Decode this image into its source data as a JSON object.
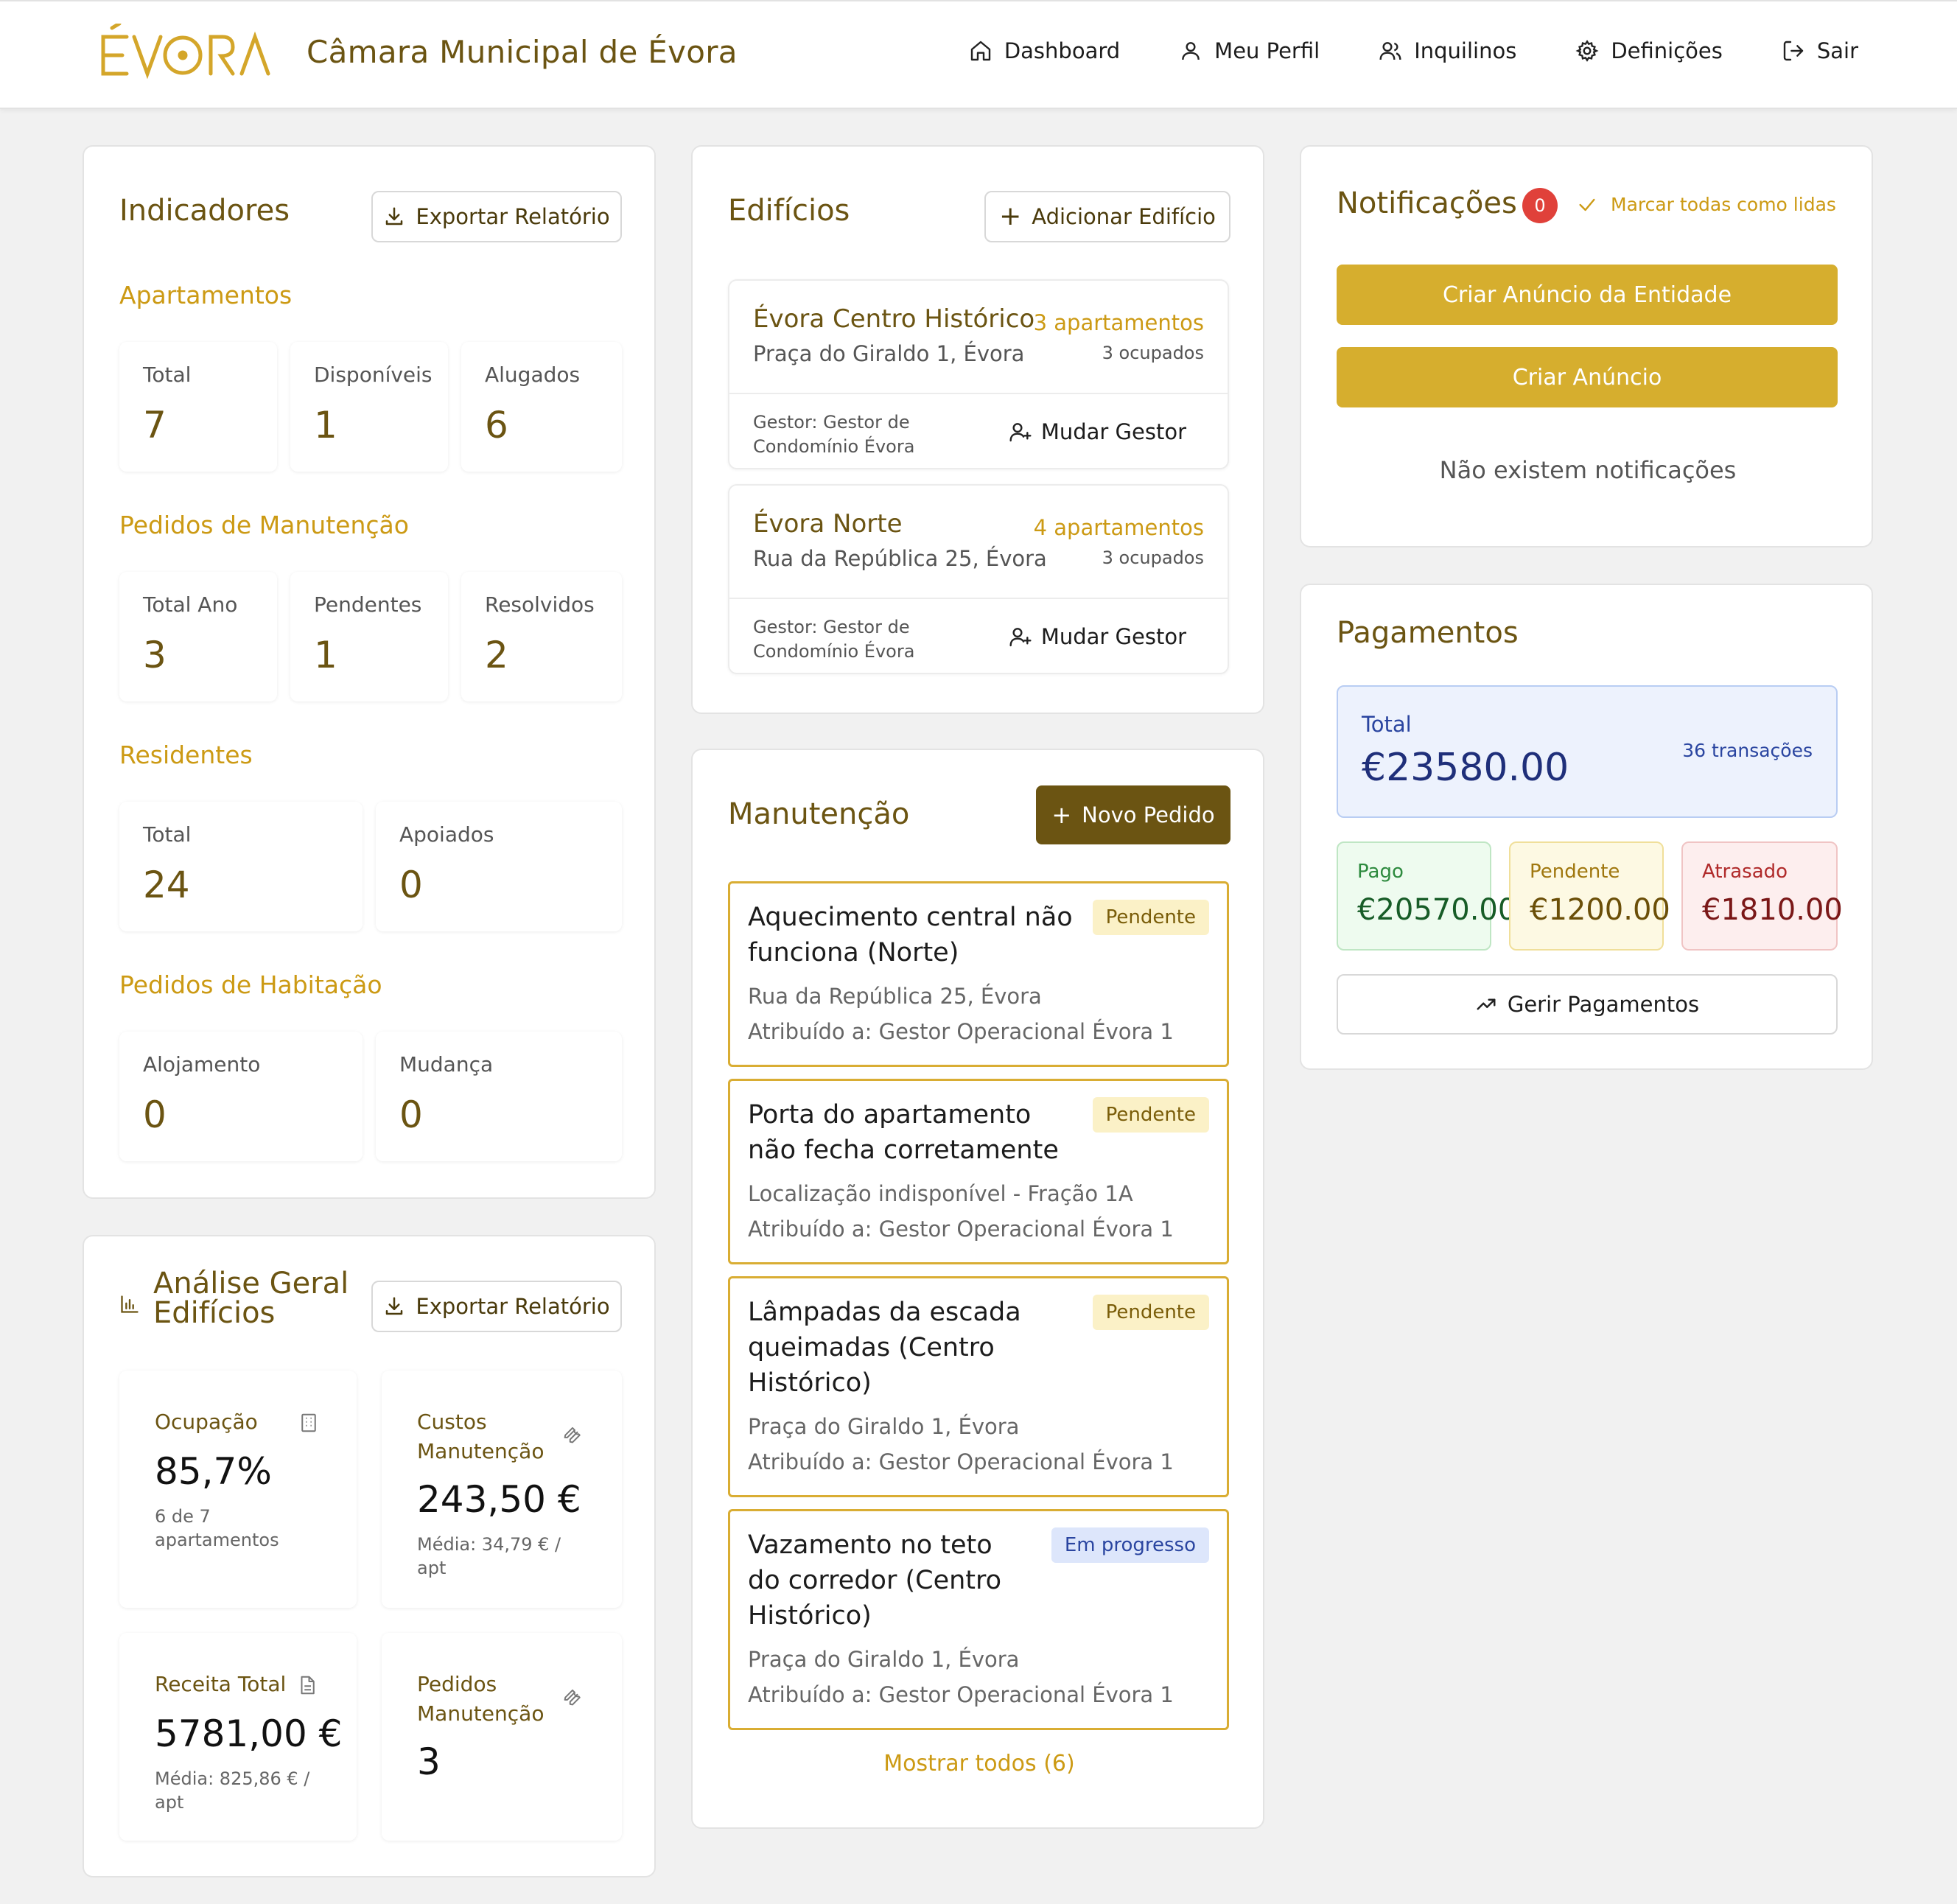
{
  "header": {
    "logo_text": "ÉVORA",
    "brand": "Câmara Municipal de Évora",
    "nav": [
      {
        "label": "Dashboard",
        "icon": "home-icon"
      },
      {
        "label": "Meu Perfil",
        "icon": "user-icon"
      },
      {
        "label": "Inquilinos",
        "icon": "users-icon"
      },
      {
        "label": "Definições",
        "icon": "gear-icon"
      },
      {
        "label": "Sair",
        "icon": "logout-icon"
      }
    ]
  },
  "indicadores": {
    "title": "Indicadores",
    "export_label": "Exportar Relatório",
    "apartamentos": {
      "heading": "Apartamentos",
      "stats": [
        {
          "label": "Total",
          "value": "7"
        },
        {
          "label": "Disponíveis",
          "value": "1"
        },
        {
          "label": "Alugados",
          "value": "6"
        }
      ]
    },
    "manutencao": {
      "heading": "Pedidos de Manutenção",
      "stats": [
        {
          "label": "Total Ano",
          "value": "3"
        },
        {
          "label": "Pendentes",
          "value": "1"
        },
        {
          "label": "Resolvidos",
          "value": "2"
        }
      ]
    },
    "residentes": {
      "heading": "Residentes",
      "stats": [
        {
          "label": "Total",
          "value": "24"
        },
        {
          "label": "Apoiados",
          "value": "0"
        }
      ]
    },
    "habitacao": {
      "heading": "Pedidos de Habitação",
      "stats": [
        {
          "label": "Alojamento",
          "value": "0"
        },
        {
          "label": "Mudança",
          "value": "0"
        }
      ]
    }
  },
  "analise": {
    "title_line1": "Análise Geral",
    "title_line2": "Edifícios",
    "export_label": "Exportar Relatório",
    "cards": [
      {
        "label": "Ocupação",
        "value": "85,7%",
        "sub": "6 de 7 apartamentos",
        "icon": "building-icon"
      },
      {
        "label": "Custos Manutenção",
        "value": "243,50 €",
        "sub": "Média: 34,79 € / apt",
        "icon": "wrench-icon"
      },
      {
        "label": "Receita Total",
        "value": "5781,00 €",
        "sub": "Média: 825,86 € / apt",
        "icon": "document-icon"
      },
      {
        "label": "Pedidos Manutenção",
        "value": "3",
        "sub": "",
        "icon": "wrench-icon"
      }
    ]
  },
  "edificios": {
    "title": "Edifícios",
    "add_label": "Adicionar Edifício",
    "items": [
      {
        "name": "Évora Centro Histórico",
        "address": "Praça do Giraldo 1, Évora",
        "apartments": "3 apartamentos",
        "occupied": "3 ocupados",
        "gestor": "Gestor: Gestor de Condomínio Évora",
        "action": "Mudar Gestor"
      },
      {
        "name": "Évora Norte",
        "address": "Rua da República 25, Évora",
        "apartments": "4 apartamentos",
        "occupied": "3 ocupados",
        "gestor": "Gestor: Gestor de Condomínio Évora",
        "action": "Mudar Gestor"
      }
    ]
  },
  "manutencao": {
    "title": "Manutenção",
    "new_label": "Novo Pedido",
    "items": [
      {
        "title": "Aquecimento central não funciona (Norte)",
        "status": "Pendente",
        "location": "Rua da República 25, Évora",
        "assigned": "Atribuído a: Gestor Operacional Évora 1"
      },
      {
        "title": "Porta do apartamento não fecha corretamente",
        "status": "Pendente",
        "location": "Localização indisponível - Fração 1A",
        "assigned": "Atribuído a: Gestor Operacional Évora 1"
      },
      {
        "title": "Lâmpadas da escada queimadas (Centro Histórico)",
        "status": "Pendente",
        "location": "Praça do Giraldo 1, Évora",
        "assigned": "Atribuído a: Gestor Operacional Évora 1"
      },
      {
        "title": "Vazamento no teto do corredor (Centro Histórico)",
        "status": "Em progresso",
        "location": "Praça do Giraldo 1, Évora",
        "assigned": "Atribuído a: Gestor Operacional Évora 1"
      }
    ],
    "show_all": "Mostrar todos (6)"
  },
  "notificacoes": {
    "title": "Notificações",
    "count": "0",
    "mark_all": "Marcar todas como lidas",
    "btn_entity": "Criar Anúncio da Entidade",
    "btn_announce": "Criar Anúncio",
    "empty": "Não existem notificações"
  },
  "pagamentos": {
    "title": "Pagamentos",
    "total_label": "Total",
    "total_value": "€23580.00",
    "transactions": "36 transações",
    "pago_label": "Pago",
    "pago_value": "€20570.00",
    "pendente_label": "Pendente",
    "pendente_value": "€1200.00",
    "atrasado_label": "Atrasado",
    "atrasado_value": "€1810.00",
    "manage_label": "Gerir Pagamentos"
  },
  "colors": {
    "brand": "#6b5412",
    "accent": "#cc9a14",
    "button_gold": "#d6ae2e",
    "dark_button": "#6b5412"
  }
}
